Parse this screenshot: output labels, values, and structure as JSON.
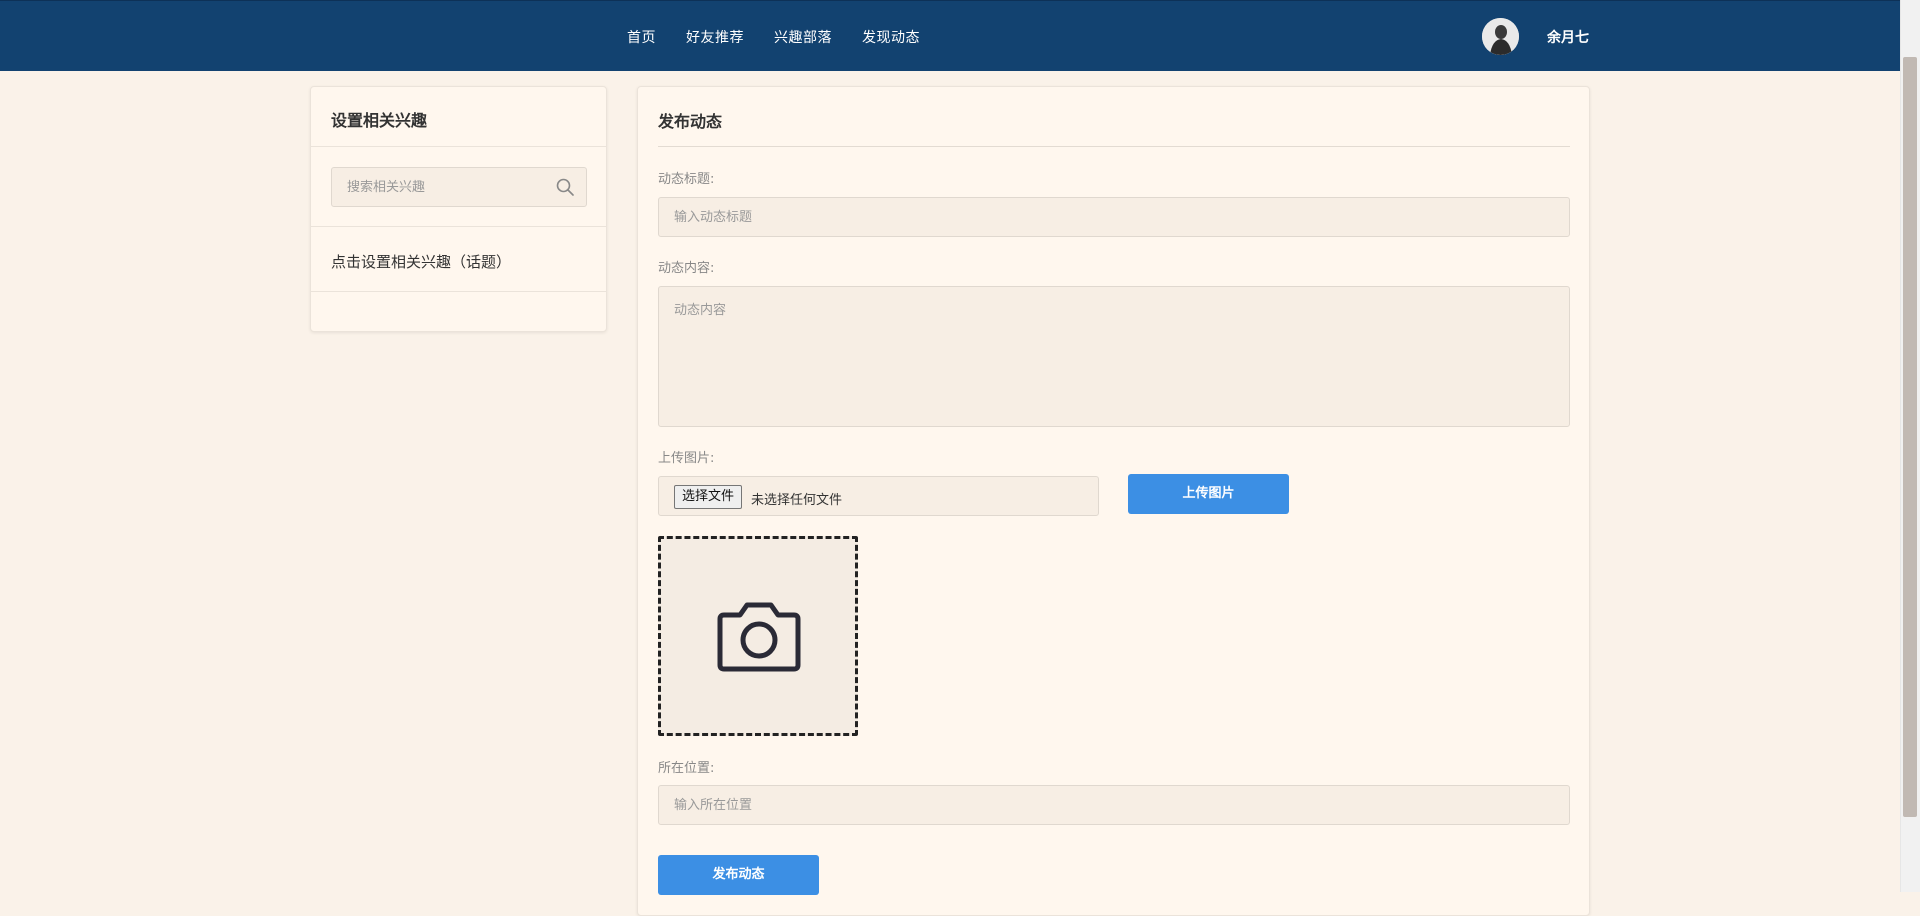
{
  "nav": {
    "links": [
      "首页",
      "好友推荐",
      "兴趣部落",
      "发现动态"
    ],
    "username": "余月七",
    "avatar_icon": "user-avatar",
    "bg_color": "#124270"
  },
  "interests_panel": {
    "title": "设置相关兴趣",
    "search_placeholder": "搜索相关兴趣",
    "search_icon": "search-icon",
    "set_link": "点击设置相关兴趣（话题）"
  },
  "post_form": {
    "title": "发布动态",
    "title_label": "动态标题:",
    "title_placeholder": "输入动态标题",
    "content_label": "动态内容:",
    "content_placeholder": "动态内容",
    "image_label": "上传图片:",
    "choose_file_label": "选择文件",
    "file_status": "未选择任何文件",
    "upload_button": "上传图片",
    "image_placeholder_icon": "camera-icon",
    "location_label": "所在位置:",
    "location_placeholder": "输入所在位置",
    "publish_button": "发布动态",
    "accent_color": "#3c8fe4"
  }
}
